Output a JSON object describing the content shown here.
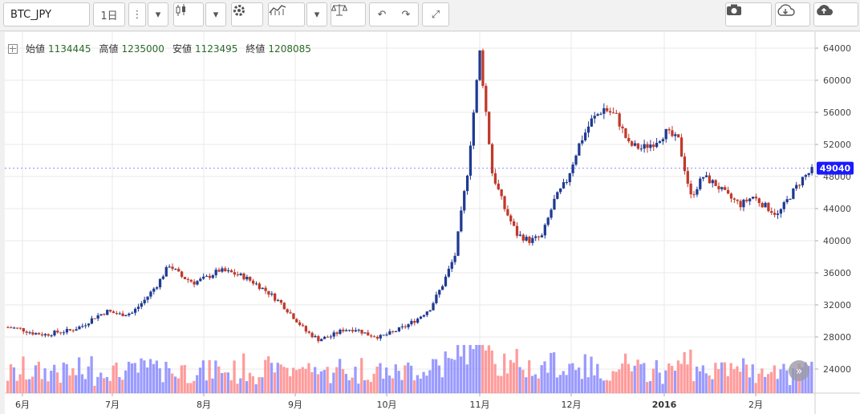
{
  "toolbar": {
    "symbol": "BTC_JPY",
    "interval": "1日",
    "icons": [
      "more-vert-icon",
      "caret-down-icon",
      "candlestick-icon",
      "caret-down-icon",
      "gear-icon",
      "indicators-icon",
      "caret-down-icon",
      "compare-scale-icon",
      "undo-icon",
      "redo-icon",
      "fullscreen-icon",
      "camera-icon",
      "cloud-download-icon",
      "cloud-upload-icon"
    ]
  },
  "ohlc": {
    "open_label": "始値",
    "open": "1134445",
    "high_label": "高値",
    "high": "1235000",
    "low_label": "安値",
    "low": "1123495",
    "close_label": "終値",
    "close": "1208085"
  },
  "colors": {
    "up": "#1f3a93",
    "down": "#c0392b",
    "vol_up": "#8888ff",
    "vol_down": "#ff8a8a",
    "price_badge": "#1a1aff"
  },
  "chart_data": {
    "type": "candlestick",
    "y_ticks": [
      "64000",
      "60000",
      "56000",
      "52000",
      "48000",
      "44000",
      "40000",
      "36000",
      "32000",
      "28000",
      "24000"
    ],
    "ylim": [
      21000,
      66000
    ],
    "x_ticks": [
      "6月",
      "7月",
      "8月",
      "9月",
      "10月",
      "11月",
      "12月",
      "2016",
      "2月"
    ],
    "last_price": "49040",
    "volume_label": "»",
    "close_series_approx": [
      29200,
      29000,
      28500,
      28300,
      28600,
      28800,
      29400,
      30500,
      31200,
      30800,
      31000,
      32600,
      34500,
      37000,
      35500,
      34800,
      35400,
      36300,
      36000,
      35500,
      34600,
      33500,
      32200,
      30500,
      28700,
      27700,
      28100,
      28900,
      29000,
      28300,
      28000,
      28600,
      29300,
      30300,
      31600,
      34500,
      38200,
      48500,
      63500,
      48500,
      44000,
      40800,
      40000,
      40500,
      45000,
      47500,
      52000,
      55000,
      56500,
      55500,
      52000,
      51500,
      52200,
      53500,
      52500,
      45500,
      48000,
      47000,
      45500,
      44500,
      45500,
      44300,
      43200,
      45600,
      47800,
      49040
    ]
  }
}
